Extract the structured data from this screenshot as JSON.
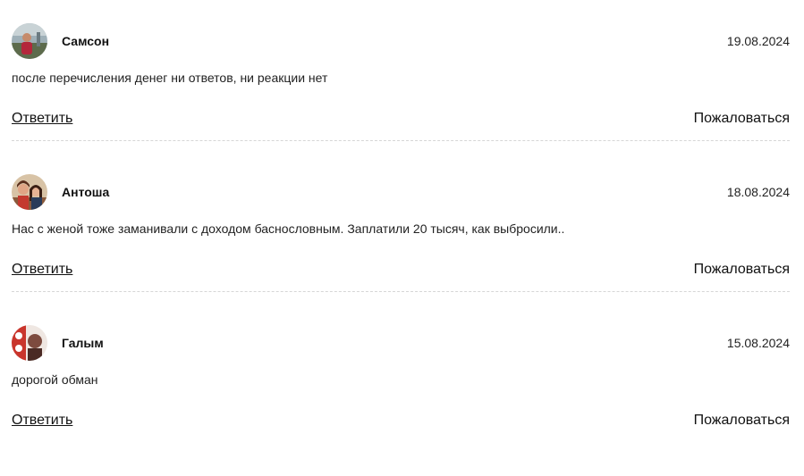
{
  "comments": [
    {
      "author": "Самсон",
      "date": "19.08.2024",
      "text": "после перечисления денег ни ответов, ни реакции нет",
      "reply_label": "Ответить",
      "report_label": "Пожаловаться"
    },
    {
      "author": "Антоша",
      "date": "18.08.2024",
      "text": "Нас с женой тоже заманивали с доходом баснословным. Заплатили 20 тысяч, как выбросили..",
      "reply_label": "Ответить",
      "report_label": "Пожаловаться"
    },
    {
      "author": "Галым",
      "date": "15.08.2024",
      "text": "дорогой обман",
      "reply_label": "Ответить",
      "report_label": "Пожаловаться"
    }
  ]
}
